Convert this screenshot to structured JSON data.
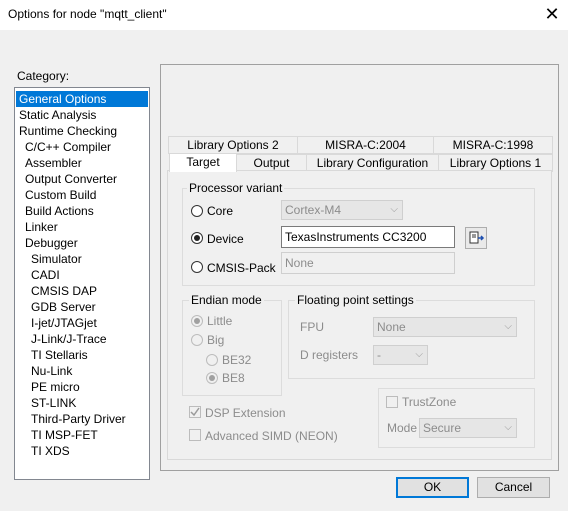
{
  "window": {
    "title": "Options for node \"mqtt_client\""
  },
  "category": {
    "label": "Category:",
    "items": [
      "General Options",
      "Static Analysis",
      "Runtime Checking",
      "C/C++ Compiler",
      "Assembler",
      "Output Converter",
      "Custom Build",
      "Build Actions",
      "Linker",
      "Debugger",
      "Simulator",
      "CADI",
      "CMSIS DAP",
      "GDB Server",
      "I-jet/JTAGjet",
      "J-Link/J-Trace",
      "TI Stellaris",
      "Nu-Link",
      "PE micro",
      "ST-LINK",
      "Third-Party Driver",
      "TI MSP-FET",
      "TI XDS"
    ],
    "selected": "General Options"
  },
  "tabs": {
    "row1": [
      "Library Options 2",
      "MISRA-C:2004",
      "MISRA-C:1998"
    ],
    "row2": [
      "Target",
      "Output",
      "Library Configuration",
      "Library Options 1"
    ],
    "active": "Target"
  },
  "processor": {
    "title": "Processor variant",
    "core_label": "Core",
    "core_value": "Cortex-M4",
    "device_label": "Device",
    "device_value": "TexasInstruments CC3200",
    "cmsis_label": "CMSIS-Pack",
    "cmsis_value": "None",
    "selected": "Device"
  },
  "endian": {
    "title": "Endian mode",
    "little": "Little",
    "big": "Big",
    "be32": "BE32",
    "be8": "BE8"
  },
  "floating": {
    "title": "Floating point settings",
    "fpu_label": "FPU",
    "fpu_value": "None",
    "dreg_label": "D registers",
    "dreg_value": "-"
  },
  "dsp_extension": "DSP Extension",
  "advanced_simd": "Advanced SIMD (NEON)",
  "trustzone": {
    "label": "TrustZone",
    "mode_label": "Mode",
    "mode_value": "Secure"
  },
  "buttons": {
    "ok": "OK",
    "cancel": "Cancel"
  }
}
